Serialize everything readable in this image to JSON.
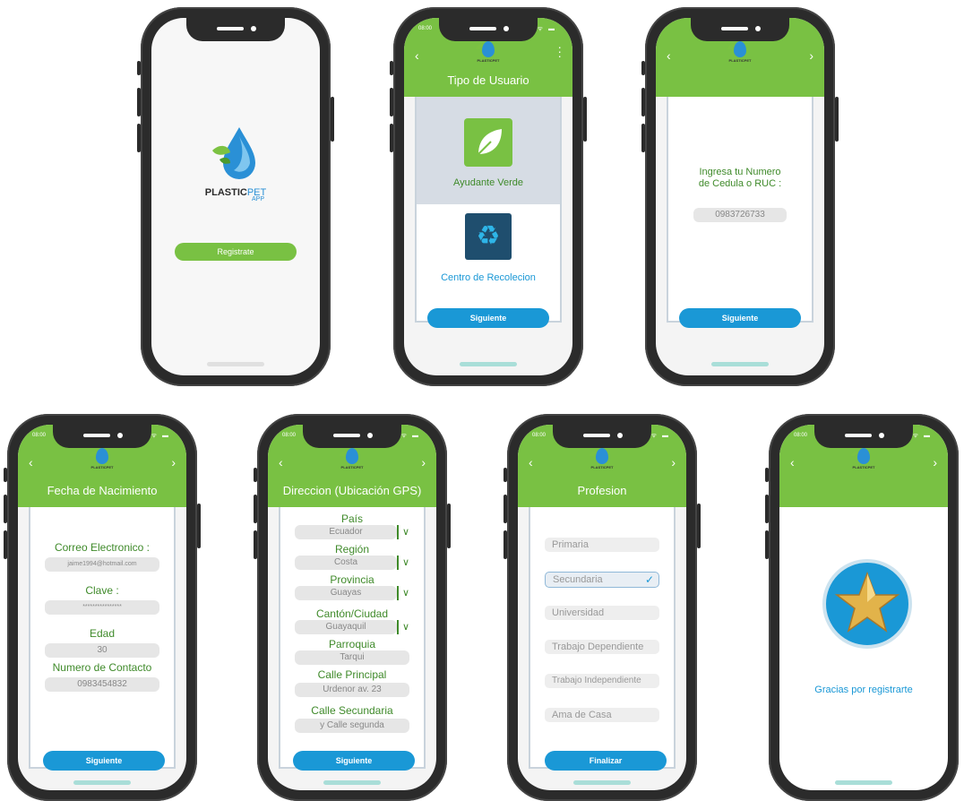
{
  "brand": {
    "name_a": "PLASTIC",
    "name_b": "PET",
    "name_c": "APP",
    "small": "PLASTICPET"
  },
  "status": {
    "time": "08:00",
    "icons": "ᯤ ▬"
  },
  "screen1": {
    "register_label": "Registrate"
  },
  "screen2": {
    "title": "Tipo de Usuario",
    "option1": "Ayudante Verde",
    "option2": "Centro de Recolecion",
    "next": "Siguiente"
  },
  "screen3": {
    "prompt_line1": "Ingresa tu Numero",
    "prompt_line2": "de Cedula o RUC :",
    "id_value": "0983726733",
    "next": "Siguiente"
  },
  "screen4": {
    "title": "Fecha de Nacimiento",
    "email_label": "Correo Electronico :",
    "email_value": "jaime1994@hotmail.com",
    "password_label": "Clave :",
    "password_value": "****************",
    "age_label": "Edad",
    "age_value": "30",
    "contact_label": "Numero de Contacto",
    "contact_value": "0983454832",
    "next": "Siguiente"
  },
  "screen5": {
    "title": "Direccion (Ubicación GPS)",
    "country_label": "País",
    "country_value": "Ecuador",
    "region_label": "Región",
    "region_value": "Costa",
    "province_label": "Provincia",
    "province_value": "Guayas",
    "city_label": "Cantón/Ciudad",
    "city_value": "Guayaquil",
    "parish_label": "Parroquia",
    "parish_value": "Tarqui",
    "main_street_label": "Calle Principal",
    "main_street_value": "Urdenor av. 23",
    "second_street_label": "Calle Secundaria",
    "second_street_value": "y Calle segunda",
    "next": "Siguiente"
  },
  "screen6": {
    "title": "Profesion",
    "options": [
      "Primaria",
      "Secundaria",
      "Universidad",
      "Trabajo Dependiente",
      "Trabajo Independiente",
      "Ama de Casa"
    ],
    "finish": "Finalizar"
  },
  "screen7": {
    "thanks": "Gracias por registrarte"
  },
  "nav": {
    "back": "‹",
    "forward": "›"
  },
  "colors": {
    "green": "#79c143",
    "blue": "#1a98d6",
    "text_green": "#3f8a2a"
  }
}
